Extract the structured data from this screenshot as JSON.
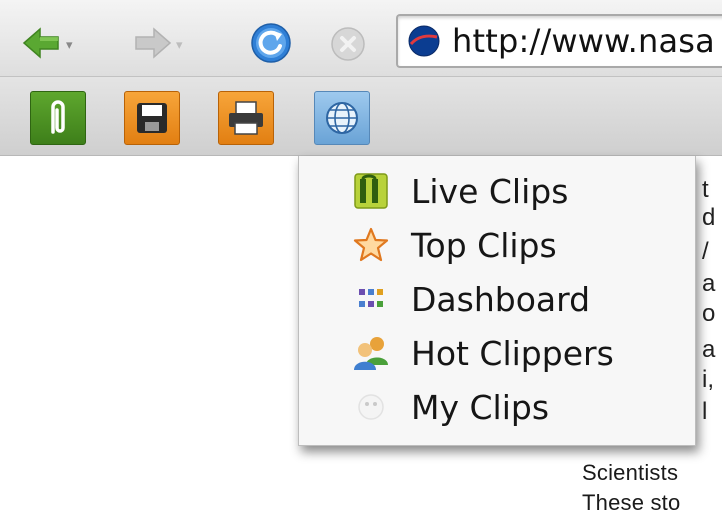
{
  "browser": {
    "address_bar": {
      "url": "http://www.nasa"
    },
    "nav_icons": [
      "back-arrow-icon",
      "forward-arrow-icon",
      "refresh-icon",
      "stop-icon",
      "nasa-site-icon"
    ]
  },
  "clip_toolbar": {
    "buttons": [
      "clip-icon",
      "save-icon",
      "print-icon",
      "globe-icon"
    ]
  },
  "clips_menu": {
    "items": [
      {
        "label": "Live Clips",
        "icon": "live-clips-icon"
      },
      {
        "label": "Top Clips",
        "icon": "star-icon"
      },
      {
        "label": "Dashboard",
        "icon": "dashboard-icon"
      },
      {
        "label": "Hot Clippers",
        "icon": "people-icon"
      },
      {
        "label": "My Clips",
        "icon": "my-clips-icon"
      }
    ]
  },
  "page": {
    "clipped_fragments": [
      "t",
      "d",
      "/",
      "a",
      "o",
      "a",
      "i,",
      "l"
    ],
    "lines": [
      "Scientists",
      "These sto"
    ]
  },
  "colors": {
    "back_arrow": "#5aa832",
    "refresh": "#2f7fd6",
    "clip_button": "#4a8f22",
    "save_print_button": "#f09326",
    "web_button": "#7fb3e2"
  }
}
